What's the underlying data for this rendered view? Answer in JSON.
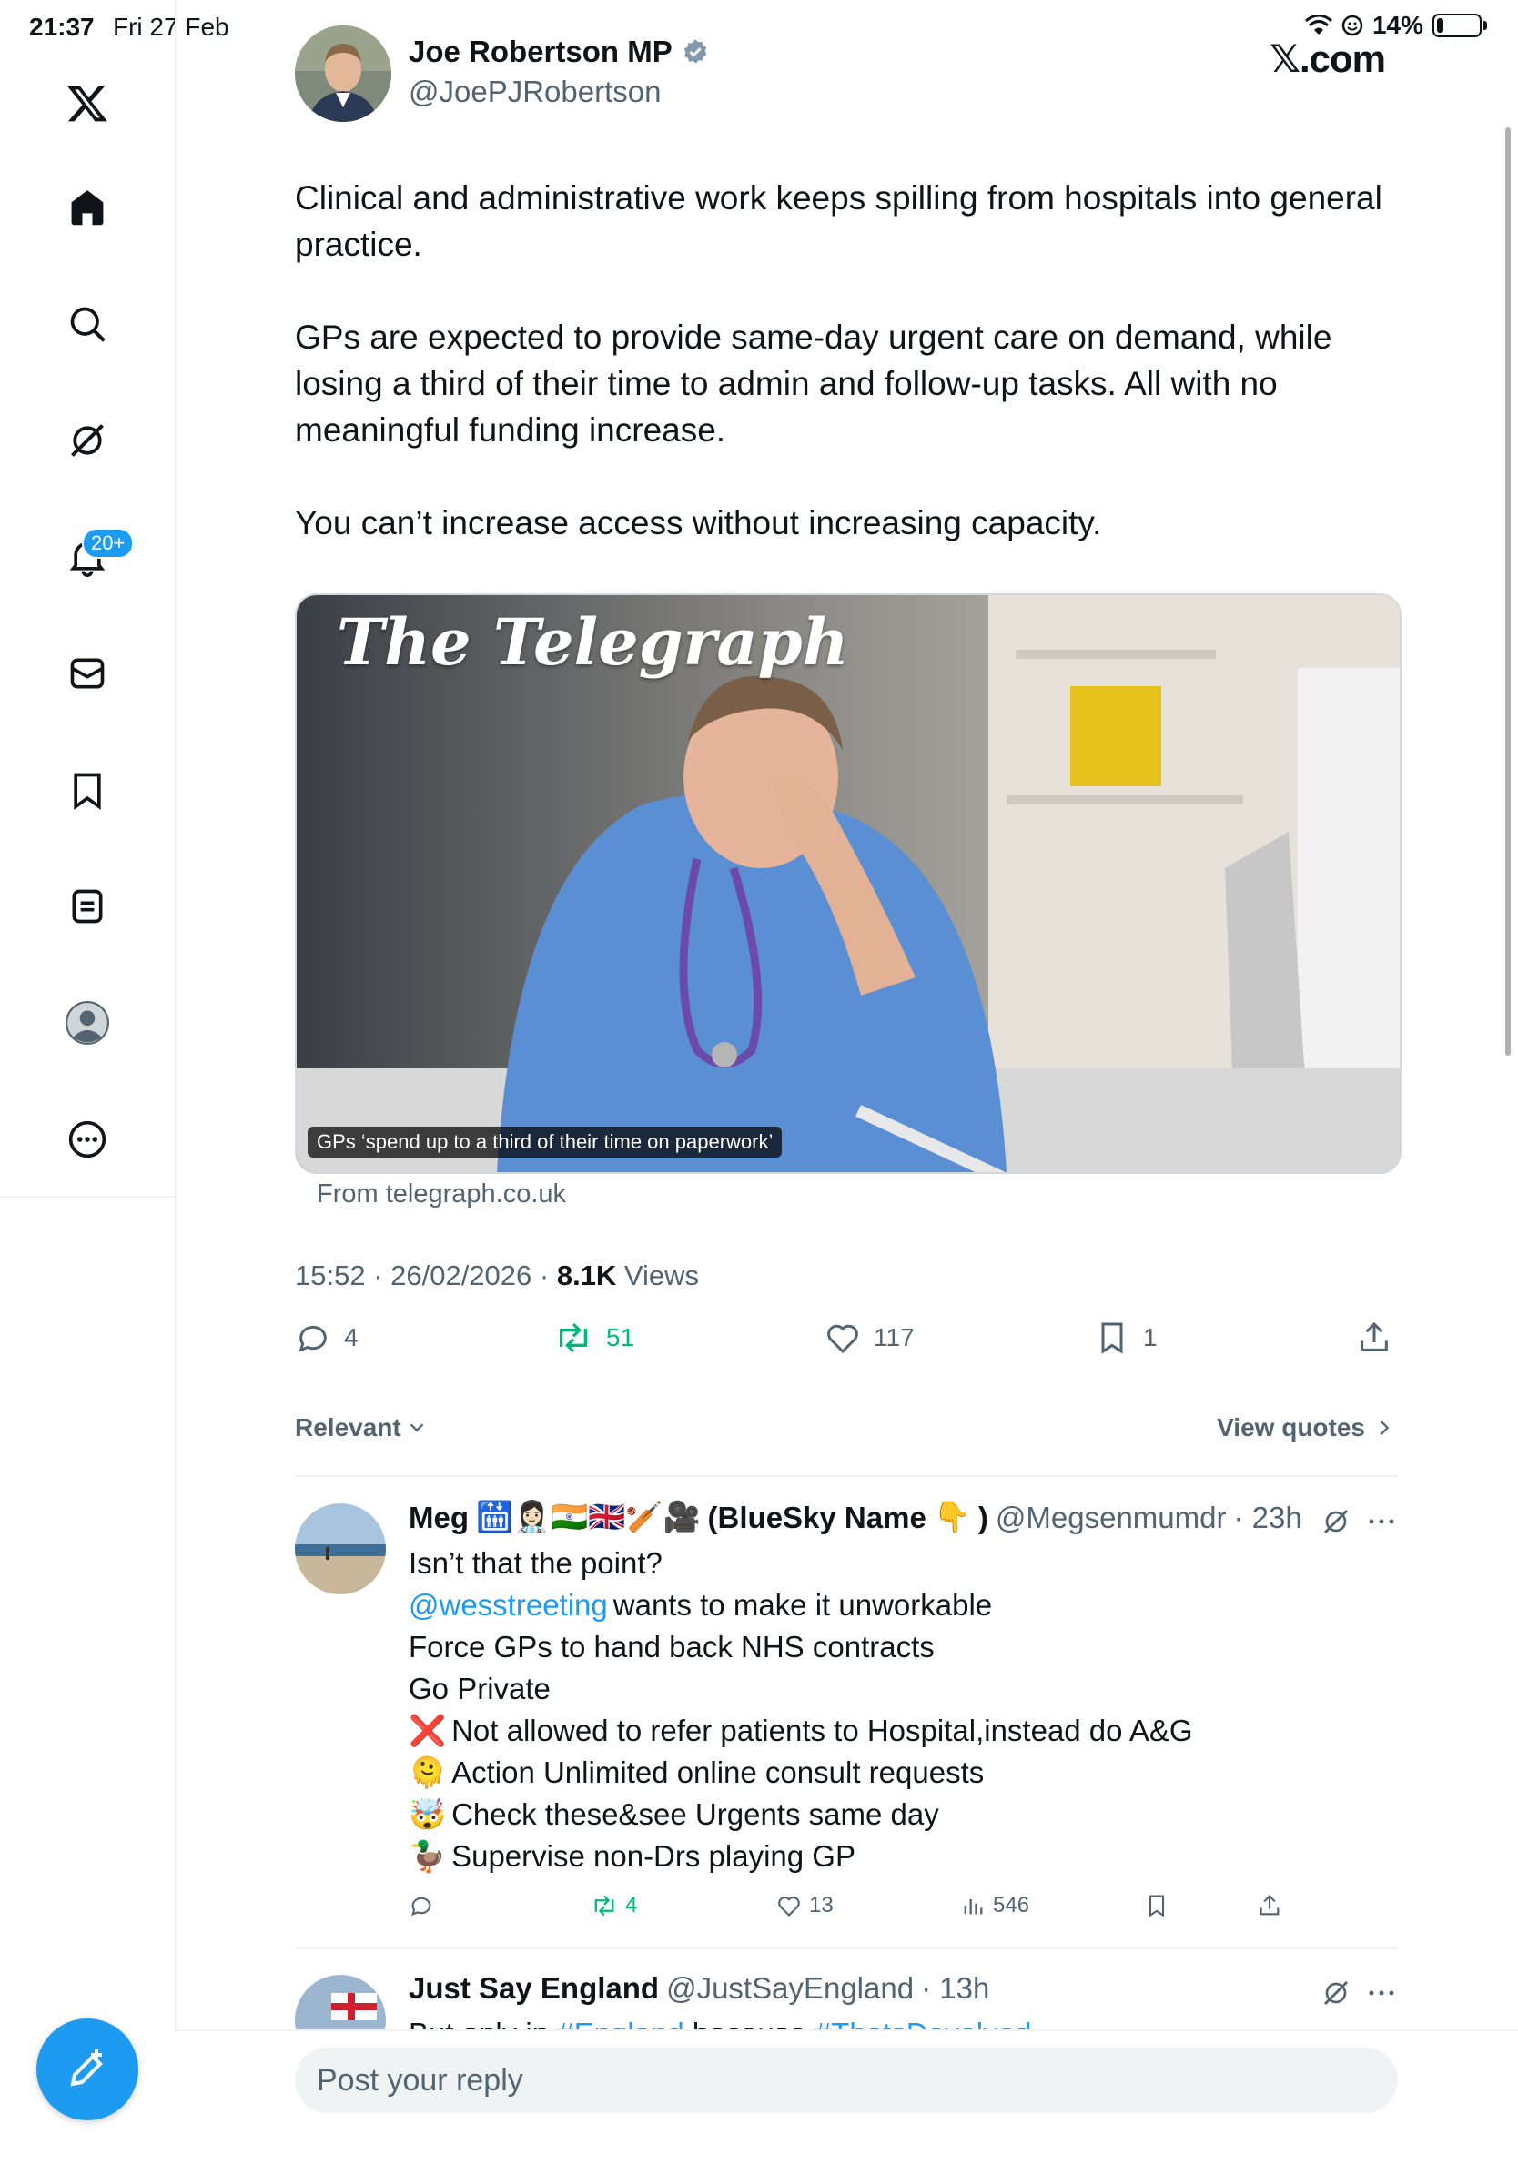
{
  "status": {
    "time": "21:37",
    "date": "Fri 27 Feb",
    "battery": "14%"
  },
  "site_label": "𝕏.com",
  "sidebar": {
    "notifications_badge": "20+",
    "items": [
      "home-icon",
      "search-icon",
      "grok-icon",
      "bell-icon",
      "messages-icon",
      "bookmark-icon",
      "lists-icon",
      "profile-icon",
      "more-icon"
    ]
  },
  "tweet": {
    "author_name": "Joe Robertson MP",
    "author_handle": "@JoePJRobertson",
    "paragraphs": [
      "Clinical and administrative work keeps spilling from hospitals into general practice.",
      "GPs are expected to provide same-day urgent care on demand, while losing a third of their time to admin and follow-up tasks. All with no meaningful funding increase.",
      "You can’t increase access without increasing capacity."
    ],
    "card": {
      "masthead": "The Telegraph",
      "caption": "GPs ‘spend up to a third of their time on paperwork’",
      "source": "From telegraph.co.uk"
    },
    "timestamp": "15:52 · 26/02/2026 · ",
    "views_count": "8.1K",
    "views_label": " Views",
    "actions": {
      "replies": "4",
      "reposts": "51",
      "likes": "117",
      "bookmarks": "1"
    },
    "accent_blue": "#1d9bf0",
    "repost_green": "#00ba7c"
  },
  "sort": {
    "relevant": "Relevant",
    "view_quotes": "View quotes"
  },
  "replies": [
    {
      "name": "Meg",
      "name_suffix": "(BlueSky Name",
      "name_end": ")",
      "handle": "@Megsenmumdr",
      "time": "· 23h",
      "lines": [
        {
          "text": "Isn’t that the point?"
        },
        {
          "mention": "@wesstreeting",
          "text": " wants to make it unworkable"
        },
        {
          "text": "Force GPs to hand back NHS contracts"
        },
        {
          "text": "Go Private"
        },
        {
          "emoji": "❌",
          "text": "Not allowed to refer patients to Hospital,instead do A&G"
        },
        {
          "emoji": "🫠",
          "text": "Action Unlimited online consult requests"
        },
        {
          "emoji": "🤯",
          "text": "Check these&see Urgents same day"
        },
        {
          "emoji": "🦆",
          "text": "Supervise non-Drs playing GP"
        }
      ],
      "stats": {
        "reposts": "4",
        "likes": "13",
        "views": "546"
      }
    },
    {
      "name": "Just Say England",
      "handle": "@JustSayEngland",
      "time": "· 13h",
      "partial_text_before": "But only in ",
      "partial_link1": "#England",
      "partial_text_mid": " because ",
      "partial_link2": "#ThatsDevolved"
    }
  ],
  "reply_box": {
    "placeholder": "Post your reply"
  }
}
